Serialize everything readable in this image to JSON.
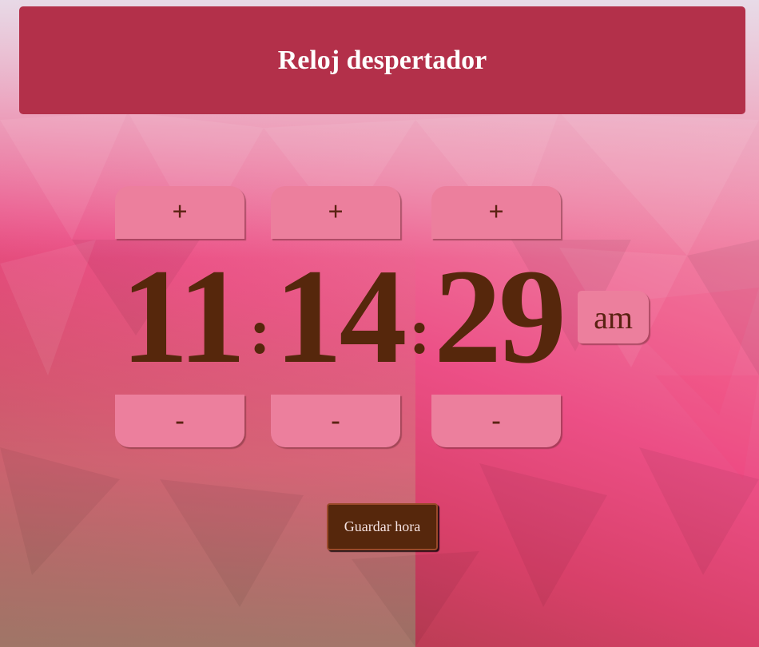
{
  "header": {
    "title": "Reloj despertador"
  },
  "clock": {
    "hours": "11",
    "minutes": "14",
    "seconds": "29",
    "separator": ":",
    "period": "am"
  },
  "controls": {
    "increment_label": "+",
    "decrement_label": "-"
  },
  "save_button": {
    "label": "Guardar hora"
  },
  "colors": {
    "header_bg": "#b3304a",
    "button_bg": "#ec7f9d",
    "digits": "#56270c",
    "save_bg": "#56270c"
  }
}
